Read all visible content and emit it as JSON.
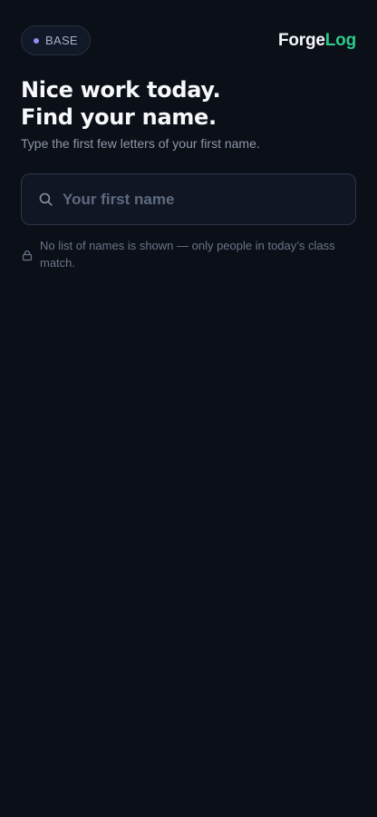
{
  "header": {
    "mode_badge": "BASE",
    "brand_part1": "Forge",
    "brand_part2": "Log"
  },
  "main": {
    "heading_line1": "Nice work today.",
    "heading_line2": "Find your name.",
    "subtitle": "Type the first few letters of your first name."
  },
  "search": {
    "value": "",
    "placeholder": "Your first name"
  },
  "privacy": {
    "note": "No list of names is shown — only people in today’s class match."
  },
  "icons": {
    "search": "search-icon",
    "lock": "lock-icon",
    "badge_dot": "status-dot-icon"
  },
  "colors": {
    "background": "#0b0f17",
    "brand_accent": "#2dc98a",
    "badge_dot": "#8b8ff2"
  }
}
